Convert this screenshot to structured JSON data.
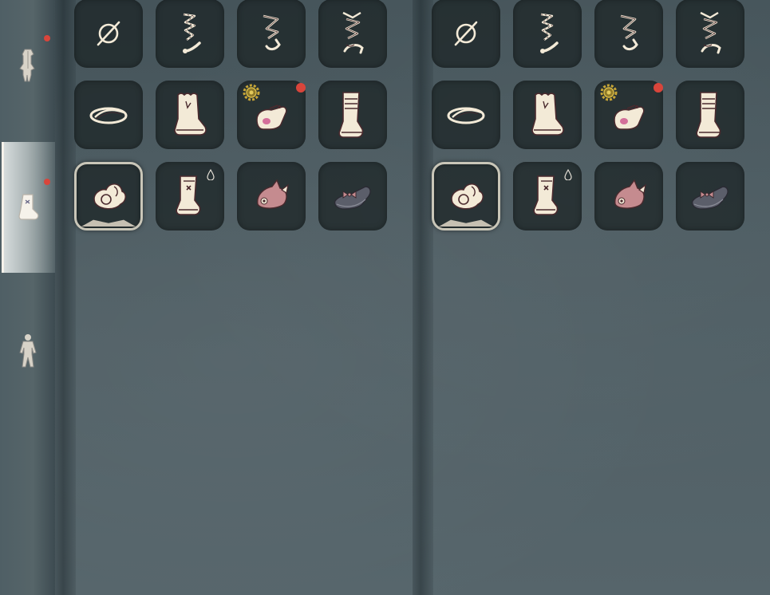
{
  "colors": {
    "background": "#4f5e64",
    "slot_bg": "#1e2628",
    "item_cream": "#f3ead7",
    "item_outline": "#4a2a2e",
    "notification_red": "#d9453b",
    "pink_item": "#c58b8f",
    "dark_shoe": "#5b5e6a"
  },
  "sidebar": {
    "tabs": [
      {
        "icon": "outfit-coat-icon",
        "active": false,
        "has_notification": true
      },
      {
        "icon": "boots-icon",
        "active": true,
        "has_notification": true
      },
      {
        "icon": "bodysuit-icon",
        "active": false,
        "has_notification": false
      }
    ]
  },
  "panels": [
    {
      "slots": [
        {
          "icon": "none-icon",
          "selected": false,
          "badge": null
        },
        {
          "icon": "lace-wrap-sandal-icon",
          "selected": false,
          "badge": null
        },
        {
          "icon": "ribbon-sandal-icon",
          "selected": false,
          "badge": null
        },
        {
          "icon": "strappy-heel-icon",
          "selected": false,
          "badge": null
        },
        {
          "icon": "flip-flop-icon",
          "selected": false,
          "badge": null
        },
        {
          "icon": "ruffle-boot-icon",
          "selected": false,
          "badge": null
        },
        {
          "icon": "mary-jane-icon",
          "selected": false,
          "badge": "new",
          "special": "gear"
        },
        {
          "icon": "tall-boot-icon",
          "selected": false,
          "badge": null
        },
        {
          "icon": "fluffy-slipper-icon",
          "selected": true,
          "badge": null
        },
        {
          "icon": "buckle-boot-icon",
          "selected": false,
          "badge": null,
          "special": "drop"
        },
        {
          "icon": "animal-slipper-icon",
          "selected": false,
          "badge": null
        },
        {
          "icon": "bow-loafer-icon",
          "selected": false,
          "badge": null
        }
      ]
    },
    {
      "slots": [
        {
          "icon": "none-icon",
          "selected": false,
          "badge": null
        },
        {
          "icon": "lace-wrap-sandal-icon",
          "selected": false,
          "badge": null
        },
        {
          "icon": "ribbon-sandal-icon",
          "selected": false,
          "badge": null
        },
        {
          "icon": "strappy-heel-icon",
          "selected": false,
          "badge": null
        },
        {
          "icon": "flip-flop-icon",
          "selected": false,
          "badge": null
        },
        {
          "icon": "ruffle-boot-icon",
          "selected": false,
          "badge": null
        },
        {
          "icon": "mary-jane-icon",
          "selected": false,
          "badge": "new",
          "special": "gear"
        },
        {
          "icon": "tall-boot-icon",
          "selected": false,
          "badge": null
        },
        {
          "icon": "fluffy-slipper-icon",
          "selected": true,
          "badge": null
        },
        {
          "icon": "buckle-boot-icon",
          "selected": false,
          "badge": null,
          "special": "drop"
        },
        {
          "icon": "animal-slipper-icon",
          "selected": false,
          "badge": null
        },
        {
          "icon": "bow-loafer-icon",
          "selected": false,
          "badge": null
        }
      ]
    }
  ]
}
